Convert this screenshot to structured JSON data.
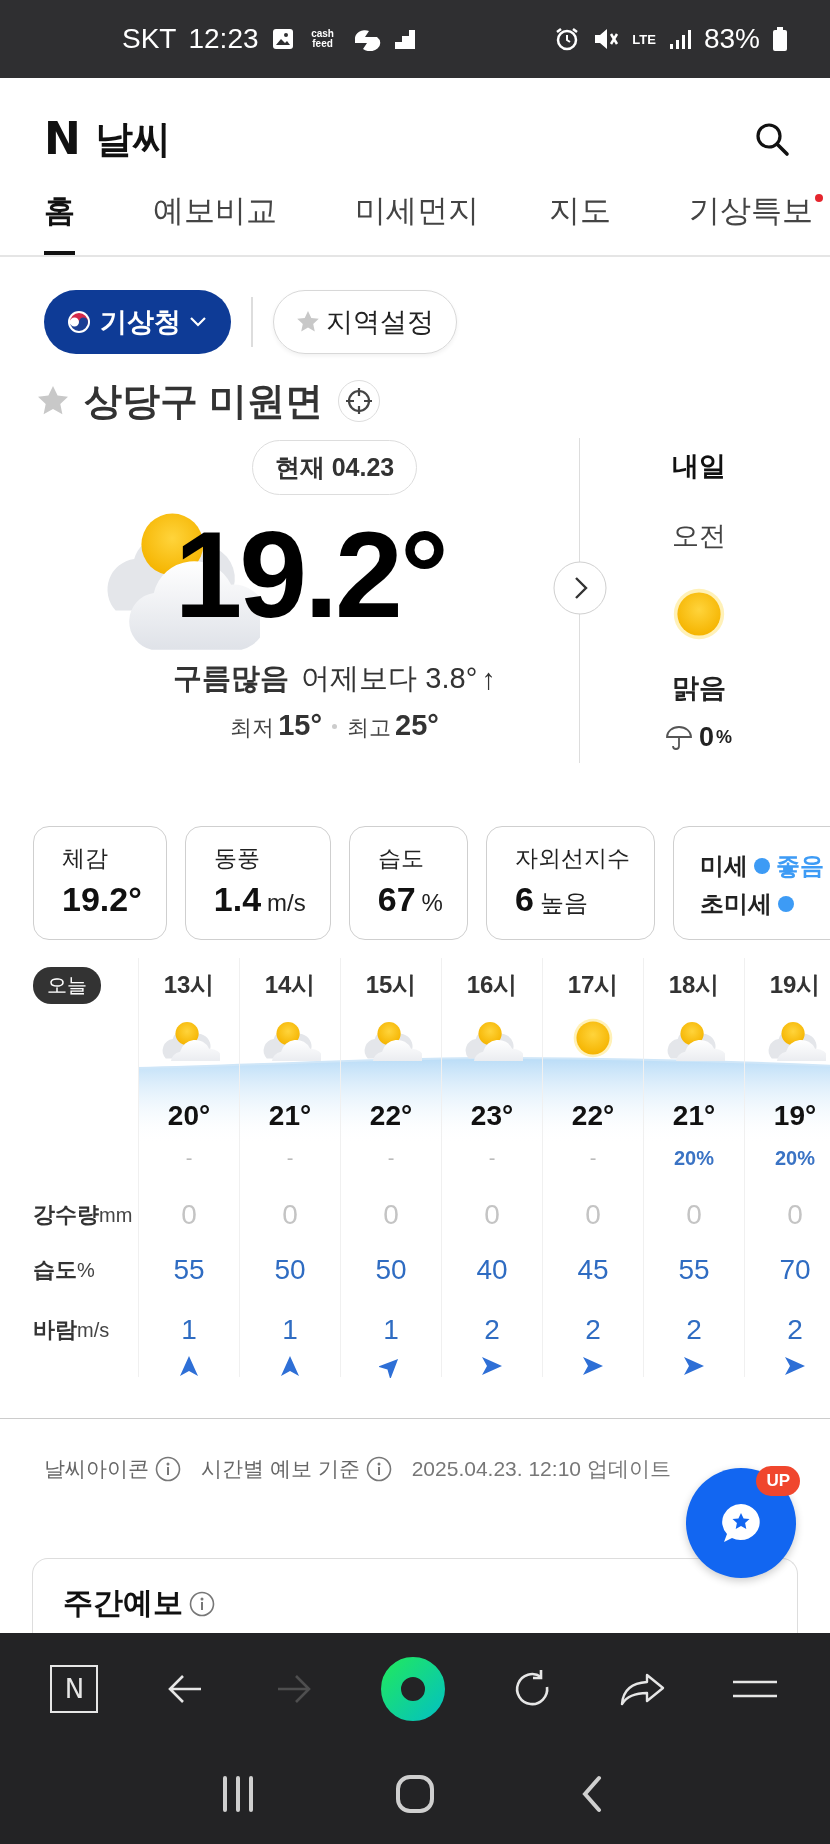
{
  "status_bar": {
    "carrier": "SKT",
    "time": "12:23",
    "notifications": [
      {
        "kind": "image"
      },
      {
        "kind": "label",
        "label": "cash feed"
      },
      {
        "kind": "swirl"
      },
      {
        "kind": "steps"
      }
    ],
    "indicators": [
      {
        "kind": "alarm"
      },
      {
        "kind": "mute"
      },
      {
        "kind": "network",
        "label": "LTE"
      },
      {
        "kind": "signal"
      }
    ],
    "battery": "83%"
  },
  "header": {
    "logo": "N",
    "title": "날씨"
  },
  "tabs": [
    {
      "label": "홈",
      "selected": true,
      "alert": false
    },
    {
      "label": "예보비교",
      "selected": false,
      "alert": false
    },
    {
      "label": "미세먼지",
      "selected": false,
      "alert": false
    },
    {
      "label": "지도",
      "selected": false,
      "alert": false
    },
    {
      "label": "기상특보",
      "selected": false,
      "alert": true
    }
  ],
  "source_button": {
    "label": "기상청"
  },
  "region_button": {
    "label": "지역설정"
  },
  "location": {
    "name": "상당구 미원면",
    "favorite": false
  },
  "current": {
    "badge": "현재 04.23",
    "icon": {
      "kind": "partly_cloudy"
    },
    "temperature": "19.2°",
    "condition": "구름많음",
    "compare": "어제보다 3.8°",
    "trend": "↑",
    "low_label": "최저",
    "low": "15°",
    "high_label": "최고",
    "high": "25°"
  },
  "tomorrow": {
    "title": "내일",
    "period": "오전",
    "icon": {
      "kind": "sunny"
    },
    "condition": "맑음",
    "rain_chance": "0",
    "rain_unit": "%"
  },
  "cards": [
    {
      "kind": "value",
      "label": "체감",
      "value": "19.2°"
    },
    {
      "kind": "value",
      "label": "동풍",
      "value": "1.4",
      "unit": "m/s"
    },
    {
      "kind": "value",
      "label": "습도",
      "value": "67",
      "unit": "%"
    },
    {
      "kind": "value",
      "label": "자외선지수",
      "value": "6",
      "unit": "높음"
    },
    {
      "kind": "air",
      "rows": [
        {
          "label": "미세",
          "grade": "좋음",
          "color": "#3d9bf5"
        },
        {
          "label": "초미세",
          "color": "#3d9bf5"
        }
      ]
    }
  ],
  "hourly": {
    "today_badge": "오늘",
    "row_labels": [
      {
        "label": "강수량",
        "unit": "mm"
      },
      {
        "label": "습도",
        "unit": "%"
      },
      {
        "label": "바람",
        "unit": "m/s"
      }
    ],
    "hours": [
      {
        "hour": "13시",
        "icon": {
          "kind": "partly_cloudy"
        },
        "temp": "20°",
        "chance": "-",
        "rain": "0",
        "humidity": "55",
        "wind": "1",
        "wind_arrow": {
          "kind": "up"
        }
      },
      {
        "hour": "14시",
        "icon": {
          "kind": "partly_cloudy"
        },
        "temp": "21°",
        "chance": "-",
        "rain": "0",
        "humidity": "50",
        "wind": "1",
        "wind_arrow": {
          "kind": "up"
        }
      },
      {
        "hour": "15시",
        "icon": {
          "kind": "partly_cloudy"
        },
        "temp": "22°",
        "chance": "-",
        "rain": "0",
        "humidity": "50",
        "wind": "1",
        "wind_arrow": {
          "kind": "up_right"
        }
      },
      {
        "hour": "16시",
        "icon": {
          "kind": "partly_cloudy"
        },
        "temp": "23°",
        "chance": "-",
        "rain": "0",
        "humidity": "40",
        "wind": "2",
        "wind_arrow": {
          "kind": "right"
        }
      },
      {
        "hour": "17시",
        "icon": {
          "kind": "sunny"
        },
        "temp": "22°",
        "chance": "-",
        "rain": "0",
        "humidity": "45",
        "wind": "2",
        "wind_arrow": {
          "kind": "right"
        }
      },
      {
        "hour": "18시",
        "icon": {
          "kind": "partly_cloudy"
        },
        "temp": "21°",
        "chance": "20%",
        "rain": "0",
        "humidity": "55",
        "wind": "2",
        "wind_arrow": {
          "kind": "right"
        }
      },
      {
        "hour": "19시",
        "icon": {
          "kind": "partly_cloudy"
        },
        "temp": "19°",
        "chance": "20%",
        "rain": "0",
        "humidity": "70",
        "wind": "2",
        "wind_arrow": {
          "kind": "right"
        }
      }
    ]
  },
  "footer": [
    {
      "kind": "info",
      "label": "날씨아이콘"
    },
    {
      "kind": "info",
      "label": "시간별 예보 기준"
    },
    {
      "kind": "text",
      "label": "2025.04.23. 12:10 업데이트"
    }
  ],
  "fab": {
    "badge": "UP"
  },
  "weekly": {
    "title": "주간예보"
  },
  "browser_bar": [
    {
      "kind": "logo",
      "label": "N",
      "disabled": false
    },
    {
      "kind": "back",
      "disabled": false
    },
    {
      "kind": "forward",
      "disabled": true
    },
    {
      "kind": "ring",
      "disabled": false
    },
    {
      "kind": "refresh",
      "disabled": false
    },
    {
      "kind": "share",
      "disabled": false
    },
    {
      "kind": "menu",
      "disabled": false
    }
  ],
  "nav_bar": [
    {
      "kind": "recents"
    },
    {
      "kind": "home"
    },
    {
      "kind": "back"
    }
  ]
}
